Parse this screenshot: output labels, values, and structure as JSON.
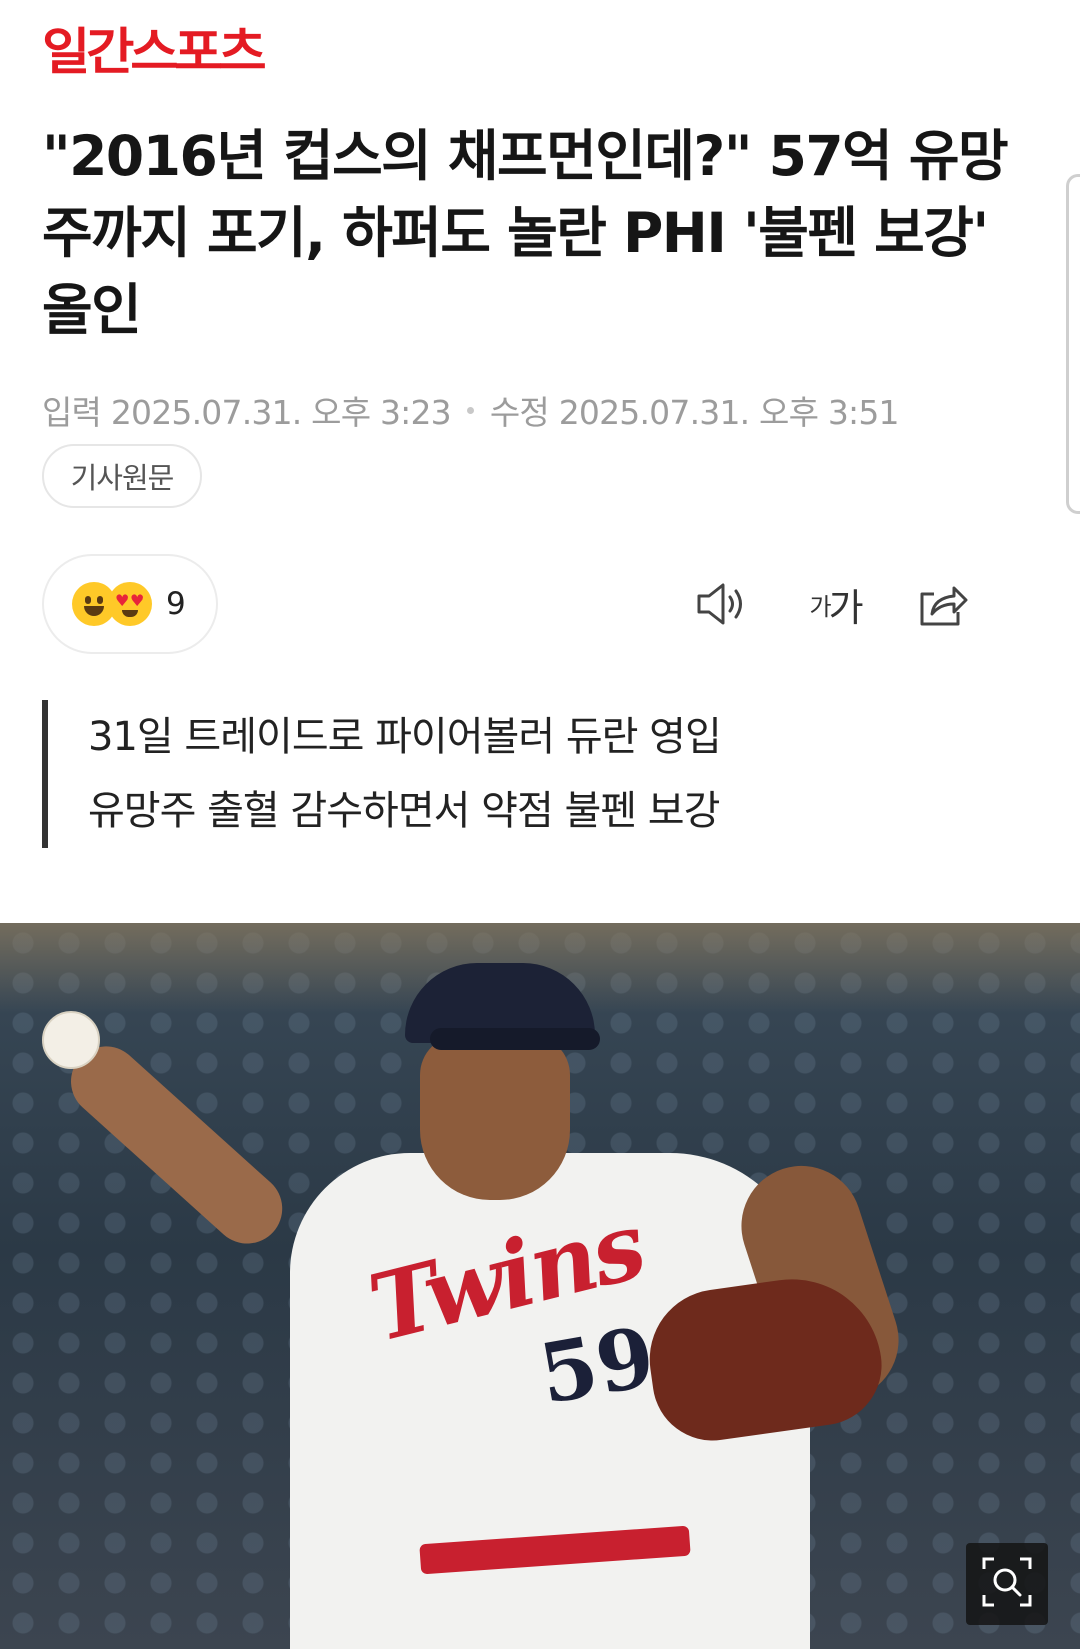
{
  "brand": {
    "logo_text": "일간스포츠",
    "accent_color": "#e41b23"
  },
  "article": {
    "headline": "\"2016년 컵스의 채프먼인데?\" 57억 유망주까지 포기, 하퍼도 놀란 PHI '불펜 보강' 올인",
    "meta": {
      "published_label": "입력",
      "published": "2025.07.31. 오후 3:23",
      "updated_label": "수정",
      "updated": "2025.07.31. 오후 3:51"
    },
    "source_button": "기사원문",
    "reactions": {
      "count": "9"
    },
    "toolbar": {
      "speaker_icon": "speaker-icon",
      "font_size_label_small": "가",
      "font_size_label_large": "가",
      "share_icon": "share-icon"
    },
    "summary": [
      "31일 트레이드로 파이어볼러 듀란 영입",
      "유망주 출혈 감수하면서 약점 불펜 보강"
    ],
    "photo": {
      "jersey_wordmark": "Twins",
      "jersey_number": "59",
      "zoom_icon": "zoom-search-icon"
    }
  }
}
